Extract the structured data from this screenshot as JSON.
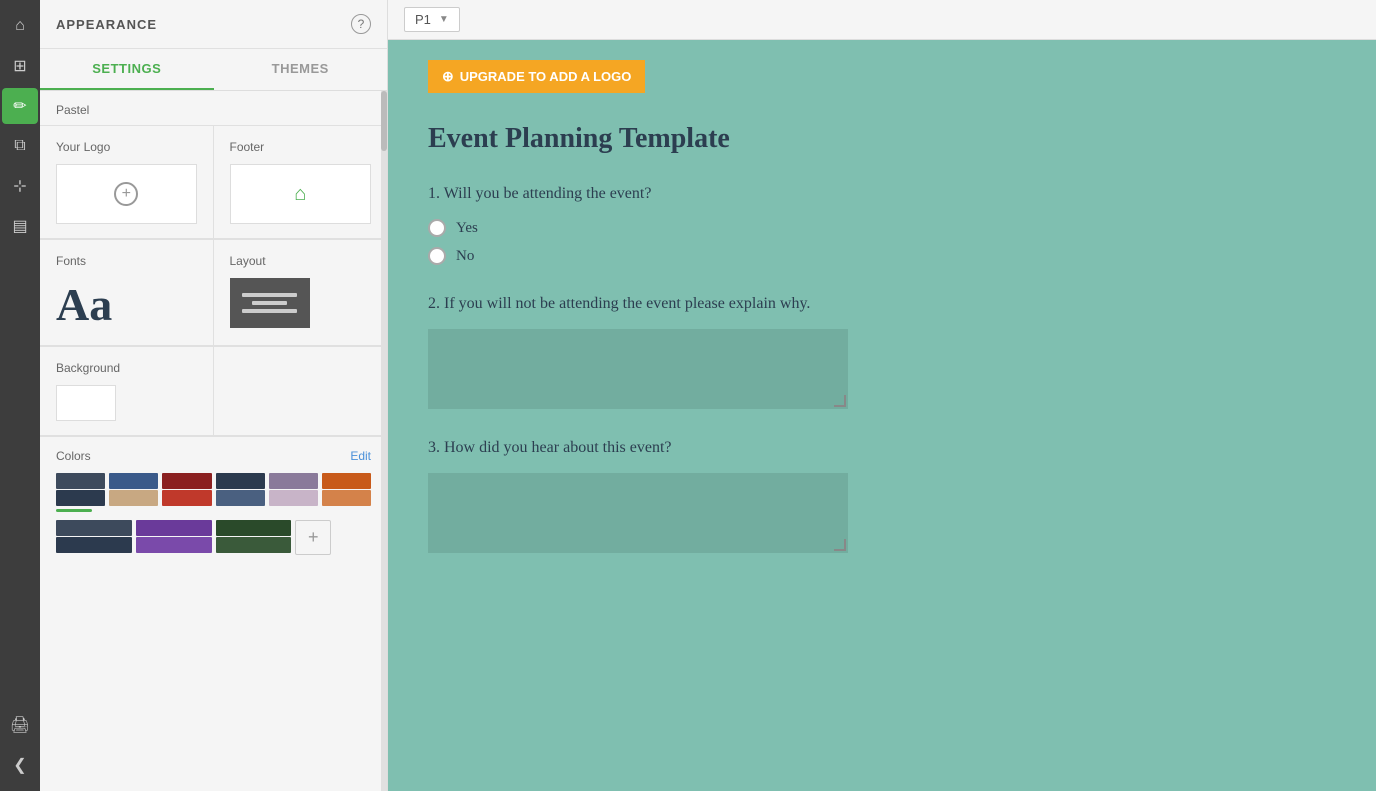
{
  "iconBar": {
    "items": [
      {
        "name": "home-icon",
        "symbol": "⌂",
        "active": false
      },
      {
        "name": "grid-icon",
        "symbol": "⊞",
        "active": false
      },
      {
        "name": "brush-icon",
        "symbol": "🖌",
        "active": true
      },
      {
        "name": "puzzle-icon",
        "symbol": "⧉",
        "active": false
      },
      {
        "name": "sliders-icon",
        "symbol": "⧉",
        "active": false
      },
      {
        "name": "layers-icon",
        "symbol": "▤",
        "active": false
      },
      {
        "name": "print-icon",
        "symbol": "🖨",
        "active": false
      },
      {
        "name": "collapse-icon",
        "symbol": "❮",
        "active": false
      }
    ]
  },
  "sidebar": {
    "title": "APPEARANCE",
    "helpTooltip": "?",
    "tabs": [
      {
        "label": "SETTINGS",
        "active": true
      },
      {
        "label": "THEMES",
        "active": false
      }
    ],
    "themeLabel": "Pastel",
    "logoSection": {
      "yourLogoLabel": "Your Logo",
      "footerLabel": "Footer"
    },
    "fontsSection": {
      "label": "Fonts",
      "sample": "Aa"
    },
    "layoutSection": {
      "label": "Layout"
    },
    "backgroundSection": {
      "label": "Background"
    },
    "colorsSection": {
      "label": "Colors",
      "editLabel": "Edit",
      "palettes": [
        {
          "top": "#3d4a5c",
          "bottom": "#2c3a4e"
        },
        {
          "top": "#3a5a8a",
          "bottom": "#c8a882"
        },
        {
          "top": "#8b2020",
          "bottom": "#c0392b"
        },
        {
          "top": "#2c3a4e",
          "bottom": "#4a6080"
        },
        {
          "top": "#8a7a9a",
          "bottom": "#c8b4c8"
        },
        {
          "top": "#c85a1a",
          "bottom": "#d4824a"
        }
      ],
      "palettes2": [
        {
          "top": "#3d4a5c",
          "bottom": "#2c3a4e"
        },
        {
          "top": "#6a3a9a",
          "bottom": "#7a4aaa"
        },
        {
          "top": "#2a4a2a",
          "bottom": "#3a5a3a"
        }
      ],
      "activeIndex": 0
    }
  },
  "topBar": {
    "pageLabel": "P1",
    "dropdownArrow": "▼"
  },
  "form": {
    "upgradeBanner": "UPGRADE TO ADD A LOGO",
    "title": "Event Planning Template",
    "questions": [
      {
        "number": "1.",
        "text": "Will you be attending the event?",
        "type": "radio",
        "options": [
          "Yes",
          "No"
        ]
      },
      {
        "number": "2.",
        "text": "If you will not be attending the event please explain why.",
        "type": "textarea"
      },
      {
        "number": "3.",
        "text": "How did you hear about this event?",
        "type": "textarea"
      }
    ]
  }
}
